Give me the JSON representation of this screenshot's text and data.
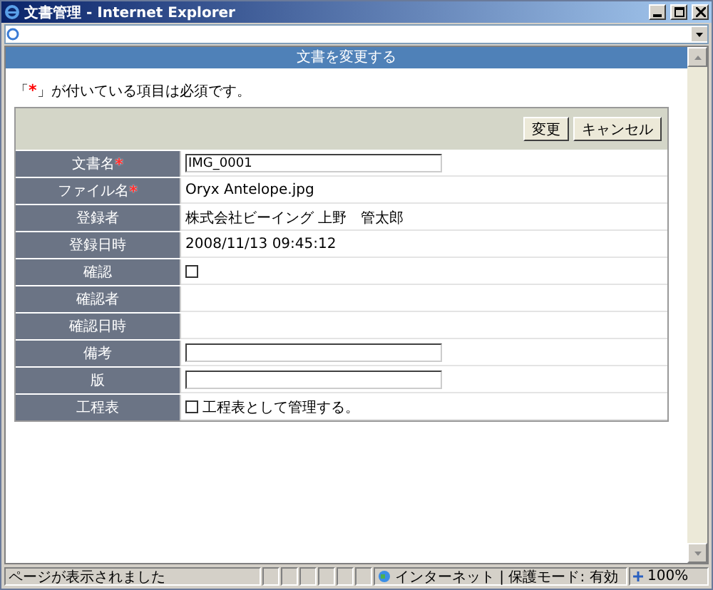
{
  "window": {
    "title": "文書管理 - Internet Explorer"
  },
  "page": {
    "header": "文書を変更する",
    "note": {
      "before": "「",
      "mark": "*",
      "after": "」が付いている項目は必須です。"
    },
    "buttons": [
      "変更",
      "キャンセル"
    ],
    "required_mark": "*",
    "fields": [
      {
        "label": "文書名",
        "required": true,
        "kind": "input",
        "value": "IMG_0001"
      },
      {
        "label": "ファイル名",
        "required": true,
        "kind": "text",
        "value": "Oryx Antelope.jpg"
      },
      {
        "label": "登録者",
        "required": false,
        "kind": "text",
        "value": "株式会社ビーイング 上野　管太郎"
      },
      {
        "label": "登録日時",
        "required": false,
        "kind": "text",
        "value": "2008/11/13 09:45:12"
      },
      {
        "label": "確認",
        "required": false,
        "kind": "checkbox",
        "checked": false
      },
      {
        "label": "確認者",
        "required": false,
        "kind": "text"
      },
      {
        "label": "確認日時",
        "required": false,
        "kind": "text"
      },
      {
        "label": "備考",
        "required": false,
        "kind": "input"
      },
      {
        "label": "版",
        "required": false,
        "kind": "input"
      },
      {
        "label": "工程表",
        "required": false,
        "kind": "checkbox",
        "checked": false,
        "text": "工程表として管理する。"
      }
    ]
  },
  "status_bar": {
    "message": "ページが表示されました",
    "zone": "インターネット | 保護モード: 有効",
    "zoom": "100%"
  }
}
